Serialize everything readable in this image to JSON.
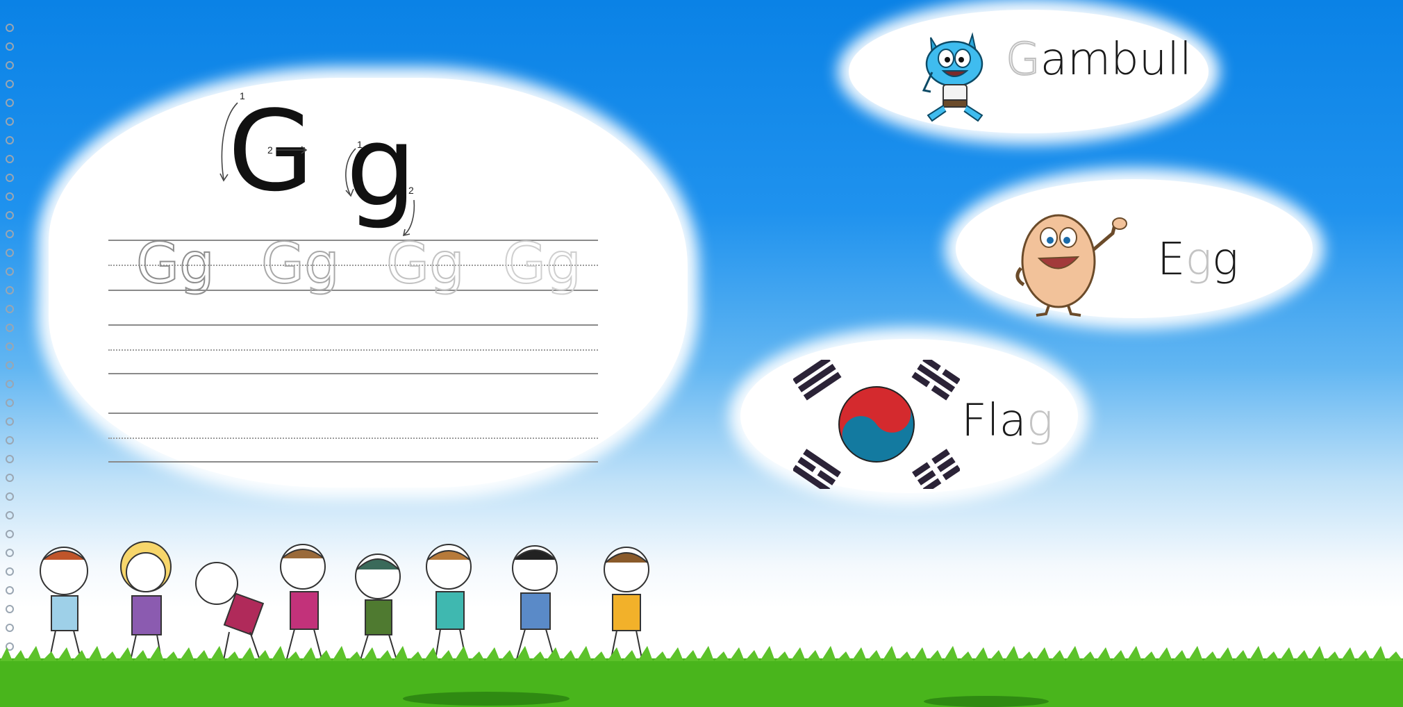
{
  "letter": {
    "upper": "G",
    "lower": "g"
  },
  "stroke_numbers": {
    "upper_1": "1",
    "upper_2": "2",
    "lower_1": "1",
    "lower_2": "2"
  },
  "trace_pairs": [
    "Gg",
    "Gg",
    "Gg",
    "Gg"
  ],
  "words": [
    {
      "highlight": "G",
      "rest": "ambull",
      "icon": "cartoon-cat-icon"
    },
    {
      "lead": "E",
      "highlight": "g",
      "rest": "g",
      "icon": "cartoon-egg-icon"
    },
    {
      "lead": "Fla",
      "highlight": "g",
      "icon": "korean-flag-icon"
    }
  ],
  "colors": {
    "sky_top": "#0a82e6",
    "grass": "#49b51c",
    "flag_red": "#d42a2e",
    "flag_blue": "#137aa0",
    "ink": "#111111",
    "ghost_letter": "#c4c4c4"
  }
}
